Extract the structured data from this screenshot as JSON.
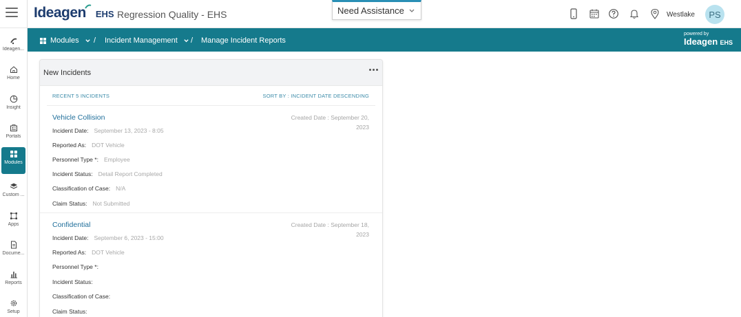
{
  "header": {
    "brand": "Ideagen",
    "brand_suffix": "EHS",
    "app_title": "Regression Quality - EHS",
    "assist_label": "Need Assistance",
    "location": "Westlake",
    "avatar_initials": "PS"
  },
  "breadcrumb": {
    "modules": "Modules",
    "sep": "/",
    "incident_management": "Incident Management",
    "current": "Manage Incident Reports"
  },
  "powered": {
    "line1": "powered by",
    "brand": "Ideagen",
    "suffix": "EHS"
  },
  "sidebar": {
    "items": [
      {
        "label": "Ideagen...",
        "icon": "ideagen-icon"
      },
      {
        "label": "Home",
        "icon": "home-icon"
      },
      {
        "label": "Insight",
        "icon": "insight-icon"
      },
      {
        "label": "Portals",
        "icon": "portals-icon"
      },
      {
        "label": "Modules",
        "icon": "modules-icon"
      },
      {
        "label": "Custom ...",
        "icon": "custom-icon"
      },
      {
        "label": "Apps",
        "icon": "apps-icon"
      },
      {
        "label": "Docume...",
        "icon": "documents-icon"
      },
      {
        "label": "Reports",
        "icon": "reports-icon"
      },
      {
        "label": "Setup",
        "icon": "setup-icon"
      }
    ]
  },
  "card": {
    "title": "New Incidents",
    "recent_label": "RECENT 5 INCIDENTS",
    "sort_label": "SORT BY : INCIDENT DATE DESCENDING",
    "incidents": [
      {
        "title": "Vehicle Collision",
        "created_line1": "Created Date : September 20,",
        "created_line2": "2023",
        "fields": [
          {
            "label": "Incident Date:",
            "value": "September 13, 2023 - 8:05"
          },
          {
            "label": "Reported As:",
            "value": "DOT Vehicle"
          },
          {
            "label": "Personnel Type *:",
            "value": "Employee"
          },
          {
            "label": "Incident Status:",
            "value": "Detail Report Completed"
          },
          {
            "label": "Classification of Case:",
            "value": "N/A"
          },
          {
            "label": "Claim Status:",
            "value": "Not Submitted"
          }
        ]
      },
      {
        "title": "Confidential",
        "created_line1": "Created Date : September 18,",
        "created_line2": "2023",
        "fields": [
          {
            "label": "Incident Date:",
            "value": "September 6, 2023 - 15:00"
          },
          {
            "label": "Reported As:",
            "value": "DOT Vehicle"
          },
          {
            "label": "Personnel Type *:",
            "value": ""
          },
          {
            "label": "Incident Status:",
            "value": ""
          },
          {
            "label": "Classification of Case:",
            "value": ""
          },
          {
            "label": "Claim Status:",
            "value": ""
          }
        ]
      }
    ]
  },
  "colors": {
    "teal": "#157a8c",
    "link": "#1f6e9a",
    "accent": "#2a8fb5"
  }
}
